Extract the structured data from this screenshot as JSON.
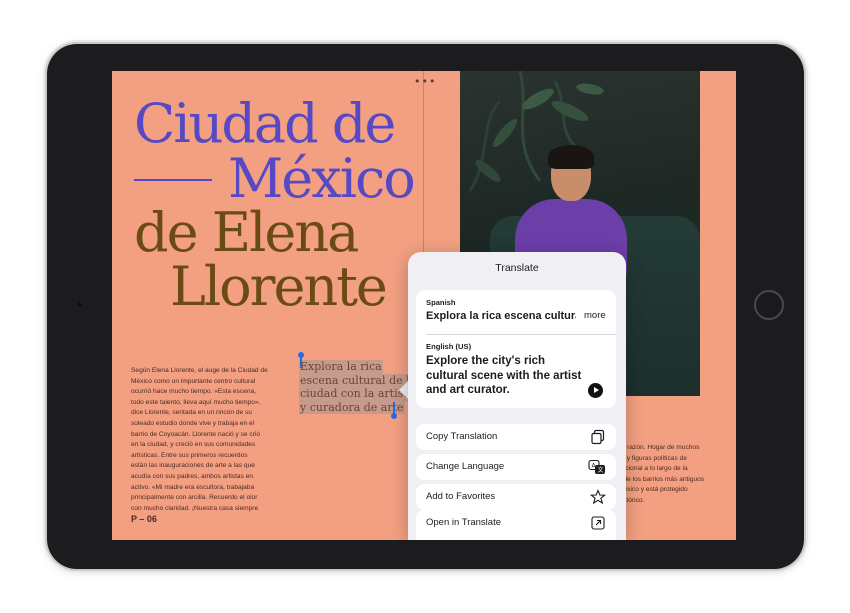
{
  "magazine": {
    "title_line1": "Ciudad de",
    "title_line2": "México",
    "title_line3": "de Elena",
    "title_line4": "Llorente",
    "top_dots": "•••",
    "body_lines": [
      "Según Elena Llorente, el auge de la Ciudad de",
      "México como un importante centro cultural",
      "ocurrió hace mucho tiempo. «Esta escena,",
      "todo este talento, lleva aquí mucho tiempo»,",
      "dice Llorente, sentada en un rincón de su",
      "soleado estudio donde vive y trabaja en el",
      "barrio de Coyoacán. Llorente nació y se crió",
      "en la ciudad, y creció en sus comunidades",
      "artísticas. Entre sus primeros recuerdos",
      "están las inauguraciones de arte a las que",
      "acudía con sus padres, ambos artistas en",
      "activo. «Mi madre era escultora, trabajaba",
      "principalmente con arcilla. Recuerdo el olor",
      "con mucho claridad. ¡Nuestra casa siempre"
    ],
    "page_number": "P – 06",
    "quote_lines": [
      "Explora la rica",
      "escena cultural de la",
      "ciudad con la artista",
      "y curadora de arte"
    ],
    "right_lines": [
      "de razón. Hogar de muchos",
      "es y figuras políticas de",
      "nacional a lo largo de la",
      "o de los barrios más antiguos",
      "México y está protegido",
      "histórico."
    ]
  },
  "translate_popover": {
    "title": "Translate",
    "source_language": "Spanish",
    "source_text": "Explora la rica escena cultural de la ciudad con la artista y curadora de arte",
    "more_label": "more",
    "target_language": "English (US)",
    "target_text": "Explore the city's rich cultural scene with the artist and art curator.",
    "play_icon": "play-icon",
    "actions": [
      {
        "label": "Copy Translation",
        "icon": "copy-icon"
      },
      {
        "label": "Change Language",
        "icon": "translate-language-icon"
      },
      {
        "label": "Add to Favorites",
        "icon": "star-icon"
      },
      {
        "label": "Open in Translate",
        "icon": "open-external-icon"
      }
    ]
  },
  "colors": {
    "page_background": "#f3a082",
    "title_purple": "#5749c3",
    "title_brown": "#6b4b14",
    "selection_handle": "#2a6ae0",
    "popover_background": "#efeff4"
  }
}
